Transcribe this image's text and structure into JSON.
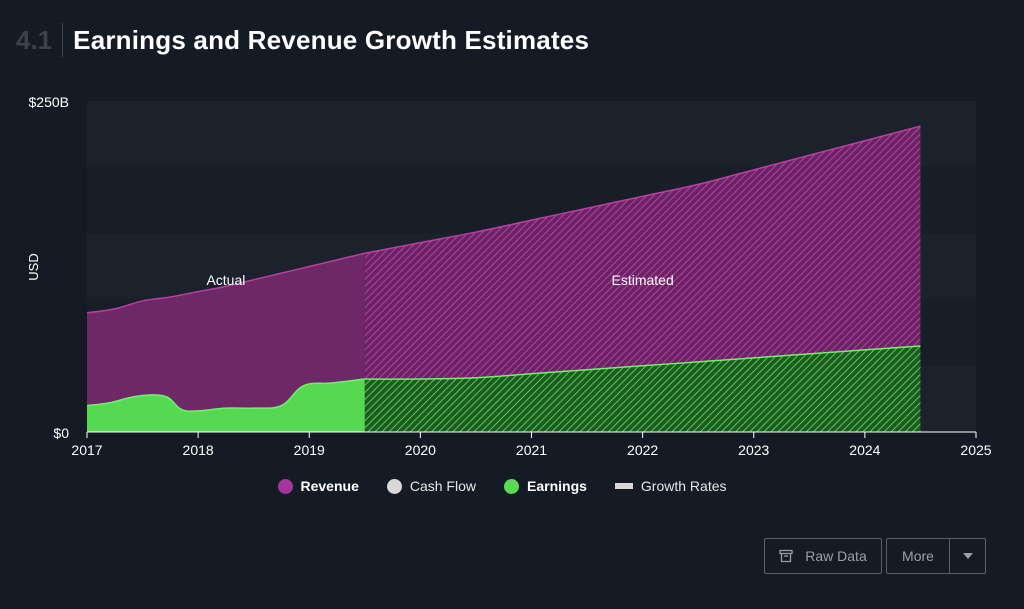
{
  "header": {
    "section_number": "4.1",
    "title": "Earnings and Revenue Growth Estimates"
  },
  "colors": {
    "revenue": "#a3359d",
    "earnings": "#5ad955",
    "cash_flow": "#d8d8d8",
    "growth_rates": "#d8d8d8",
    "background": "#151b24"
  },
  "legend": [
    {
      "label": "Revenue",
      "color": "#a3359d",
      "icon": "revenue-dot-icon",
      "active": true
    },
    {
      "label": "Cash Flow",
      "color": "#d8d8d8",
      "icon": "cash-flow-dot-icon",
      "active": false
    },
    {
      "label": "Earnings",
      "color": "#5ad955",
      "icon": "earnings-dot-icon",
      "active": true
    },
    {
      "label": "Growth Rates",
      "color": "#d8d8d8",
      "icon": "growth-rates-bar-icon",
      "active": false
    }
  ],
  "buttons": {
    "raw_data": "Raw Data",
    "raw_data_icon": "archive-icon",
    "more": "More",
    "more_icon": "caret-down-icon"
  },
  "chart_data": {
    "type": "area",
    "title": "Earnings and Revenue Growth Estimates",
    "ylabel": "USD",
    "y_tick_labels": [
      "$0",
      "$250B"
    ],
    "ylim": [
      0,
      250
    ],
    "xlim": [
      2017,
      2025
    ],
    "x_ticks": [
      2017,
      2018,
      2019,
      2020,
      2021,
      2022,
      2023,
      2024,
      2025
    ],
    "split_x": 2019.5,
    "annotations": [
      "Actual",
      "Estimated"
    ],
    "series": [
      {
        "name": "Revenue",
        "x": [
          2017.0,
          2017.25,
          2017.5,
          2017.75,
          2018.0,
          2018.25,
          2018.5,
          2018.75,
          2019.0,
          2019.25,
          2019.5,
          2020.0,
          2020.5,
          2021.0,
          2021.5,
          2022.0,
          2022.5,
          2023.0,
          2023.5,
          2024.0,
          2024.5
        ],
        "values": [
          90,
          93,
          99,
          102,
          106,
          110,
          115,
          120,
          125,
          130,
          135,
          143,
          151,
          160,
          169,
          178,
          187,
          198,
          209,
          220,
          231
        ]
      },
      {
        "name": "Earnings",
        "x": [
          2017.0,
          2017.2,
          2017.45,
          2017.7,
          2017.85,
          2018.0,
          2018.25,
          2018.5,
          2018.75,
          2018.95,
          2019.2,
          2019.5,
          2020.0,
          2020.5,
          2021.0,
          2021.5,
          2022.0,
          2022.5,
          2023.0,
          2023.5,
          2024.0,
          2024.5
        ],
        "values": [
          20,
          22,
          27,
          27,
          17,
          16,
          18,
          18,
          20,
          35,
          37,
          40,
          40,
          41,
          44,
          47,
          50,
          53,
          56,
          59,
          62,
          65
        ]
      }
    ]
  }
}
